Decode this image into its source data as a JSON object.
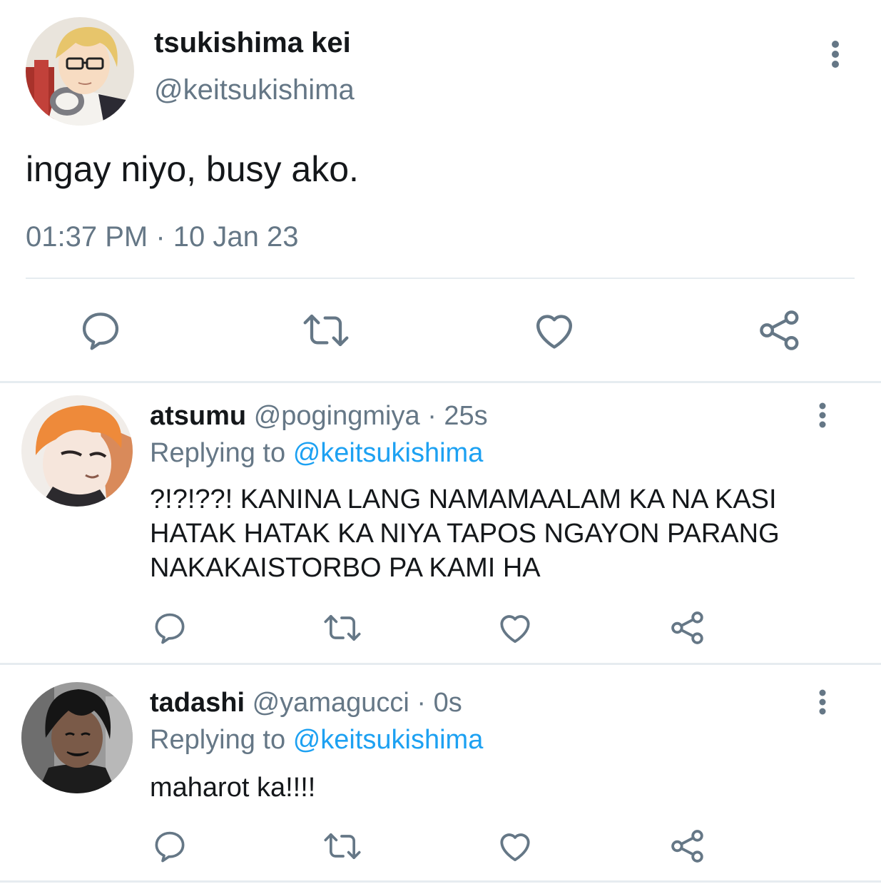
{
  "main_tweet": {
    "name": "tsukishima kei",
    "handle": "@keitsukishima",
    "text": "ingay niyo, busy ako.",
    "time": "01:37 PM",
    "dot": "·",
    "date": "10 Jan 23",
    "avatar_icon": "avatar-glasses-blond",
    "actions": [
      "reply-icon",
      "retweet-icon",
      "like-icon",
      "share-icon"
    ]
  },
  "replies": [
    {
      "name": "atsumu",
      "handle": "@pogingmiya",
      "time": "· 25s",
      "replying_label": "Replying to",
      "replying_to": "@keitsukishima",
      "text": "?!?!??! KANINA LANG NAMAMAALAM KA NA KASI HATAK HATAK KA NIYA TAPOS NGAYON PARANG NAKAKAISTORBO PA KAMI HA",
      "avatar_icon": "avatar-orange-hair"
    },
    {
      "name": "tadashi",
      "handle": "@yamagucci",
      "time": "· 0s",
      "replying_label": "Replying to",
      "replying_to": "@keitsukishima",
      "text": "maharot ka!!!!",
      "avatar_icon": "avatar-dark-hair"
    }
  ],
  "colors": {
    "text": "#14171a",
    "secondary": "#657786",
    "link": "#1da1f2",
    "divider": "#e6ecf0"
  }
}
